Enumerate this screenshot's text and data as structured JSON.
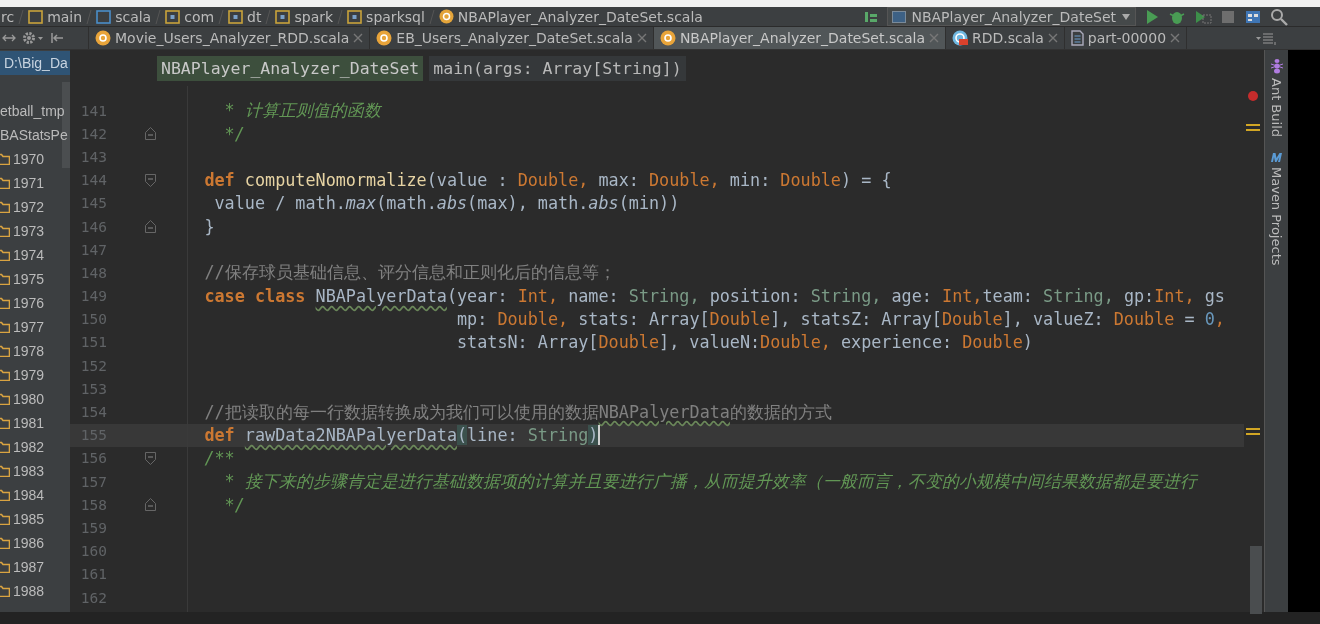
{
  "navigation_bar": {
    "crumbs": [
      {
        "label": "rc",
        "kind": "plain"
      },
      {
        "label": "main",
        "kind": "folder"
      },
      {
        "label": "scala",
        "kind": "source-folder"
      },
      {
        "label": "com",
        "kind": "package"
      },
      {
        "label": "dt",
        "kind": "package"
      },
      {
        "label": "spark",
        "kind": "package"
      },
      {
        "label": "sparksql",
        "kind": "package"
      },
      {
        "label": "NBAPlayer_Analyzer_DateSet.scala",
        "kind": "file"
      }
    ],
    "run_configuration": "NBAPlayer_Analyzer_DateSet"
  },
  "tabs": [
    {
      "label": "Movie_Users_Analyzer_RDD.scala",
      "kind": "object",
      "selected": false
    },
    {
      "label": "EB_Users_Analyzer_DateSet.scala",
      "kind": "object",
      "selected": false
    },
    {
      "label": "NBAPlayer_Analyzer_DateSet.scala",
      "kind": "object",
      "selected": true
    },
    {
      "label": "RDD.scala",
      "kind": "class",
      "selected": false
    },
    {
      "label": "part-00000",
      "kind": "text",
      "selected": false
    }
  ],
  "project_tree": [
    {
      "label": "D:\\Big_Da",
      "selected": true
    },
    {
      "label": "etball_tmp",
      "selected": false
    },
    {
      "label": "BAStatsPe",
      "selected": false,
      "children": [
        {
          "label": "1970",
          "selected": false
        },
        {
          "label": "1971",
          "selected": false
        },
        {
          "label": "1972",
          "selected": false
        },
        {
          "label": "1973",
          "selected": false
        },
        {
          "label": "1974",
          "selected": false
        },
        {
          "label": "1975",
          "selected": false
        },
        {
          "label": "1976",
          "selected": false
        },
        {
          "label": "1977",
          "selected": false
        },
        {
          "label": "1978",
          "selected": false
        },
        {
          "label": "1979",
          "selected": false
        },
        {
          "label": "1980",
          "selected": false
        },
        {
          "label": "1981",
          "selected": false
        },
        {
          "label": "1982",
          "selected": false
        },
        {
          "label": "1983",
          "selected": false
        },
        {
          "label": "1984",
          "selected": false
        },
        {
          "label": "1985",
          "selected": false
        },
        {
          "label": "1986",
          "selected": false
        },
        {
          "label": "1987",
          "selected": false
        },
        {
          "label": "1988",
          "selected": false
        }
      ]
    }
  ],
  "editor": {
    "breadcrumbs": [
      {
        "label": "NBAPlayer_Analyzer_DateSet",
        "selected": true
      },
      {
        "label": "main(args: Array[String])",
        "selected": false
      }
    ],
    "lines": [
      {
        "number": "141",
        "current": false,
        "tokens": [
          {
            "kind": "doc",
            "text": "      * 计算正则值的函数"
          }
        ]
      },
      {
        "number": "142",
        "current": false,
        "fold_end": true,
        "tokens": [
          {
            "kind": "doc",
            "text": "      */"
          }
        ]
      },
      {
        "number": "143",
        "current": false
      },
      {
        "number": "144",
        "current": false,
        "fold_start": true,
        "tokens": [
          {
            "kind": "keyword",
            "text": "    def "
          },
          {
            "kind": "function",
            "text": "computeNomormalize"
          },
          {
            "kind": "plain",
            "text": "(value : "
          },
          {
            "kind": "type",
            "text": "Double,"
          },
          {
            "kind": "plain",
            "text": " max: "
          },
          {
            "kind": "type",
            "text": "Double,"
          },
          {
            "kind": "plain",
            "text": " min: "
          },
          {
            "kind": "type",
            "text": "Double"
          },
          {
            "kind": "plain",
            "text": ") = {"
          }
        ]
      },
      {
        "number": "145",
        "current": false,
        "tokens": [
          {
            "kind": "plain",
            "text": "     value / math."
          },
          {
            "kind": "italic",
            "text": "max"
          },
          {
            "kind": "plain",
            "text": "(math."
          },
          {
            "kind": "italic",
            "text": "abs"
          },
          {
            "kind": "plain",
            "text": "(max), math."
          },
          {
            "kind": "italic",
            "text": "abs"
          },
          {
            "kind": "plain",
            "text": "(min))"
          }
        ]
      },
      {
        "number": "146",
        "current": false,
        "fold_end": true,
        "tokens": [
          {
            "kind": "plain",
            "text": "    }"
          }
        ]
      },
      {
        "number": "147",
        "current": false
      },
      {
        "number": "148",
        "current": false,
        "tokens": [
          {
            "kind": "comment",
            "text": "    //保存球员基础信息、评分信息和正则化后的信息等；"
          }
        ]
      },
      {
        "number": "149",
        "current": false,
        "tokens": [
          {
            "kind": "keyword",
            "text": "    case class "
          },
          {
            "kind": "typo",
            "text": "NBAPalyerData"
          },
          {
            "kind": "plain",
            "text": "(year: "
          },
          {
            "kind": "type",
            "text": "Int,"
          },
          {
            "kind": "plain",
            "text": " name: "
          },
          {
            "kind": "string_type",
            "text": "String,"
          },
          {
            "kind": "plain",
            "text": " position: "
          },
          {
            "kind": "string_type",
            "text": "String,"
          },
          {
            "kind": "plain",
            "text": " age: "
          },
          {
            "kind": "type",
            "text": "Int,"
          },
          {
            "kind": "plain",
            "text": "team: "
          },
          {
            "kind": "string_type",
            "text": "String,"
          },
          {
            "kind": "plain",
            "text": " gp:"
          },
          {
            "kind": "type",
            "text": "Int,"
          },
          {
            "kind": "plain",
            "text": " gs"
          }
        ]
      },
      {
        "number": "150",
        "current": false,
        "tokens": [
          {
            "kind": "plain",
            "text": "                             mp: "
          },
          {
            "kind": "type",
            "text": "Double,"
          },
          {
            "kind": "plain",
            "text": " stats: Array["
          },
          {
            "kind": "type",
            "text": "Double"
          },
          {
            "kind": "plain",
            "text": "], statsZ: Array["
          },
          {
            "kind": "type",
            "text": "Double"
          },
          {
            "kind": "plain",
            "text": "], valueZ: "
          },
          {
            "kind": "type",
            "text": "Double"
          },
          {
            "kind": "plain",
            "text": " = "
          },
          {
            "kind": "number",
            "text": "0"
          },
          {
            "kind": "type",
            "text": ","
          }
        ]
      },
      {
        "number": "151",
        "current": false,
        "tokens": [
          {
            "kind": "plain",
            "text": "                             statsN: Array["
          },
          {
            "kind": "type",
            "text": "Double"
          },
          {
            "kind": "plain",
            "text": "], valueN:"
          },
          {
            "kind": "type",
            "text": "Double,"
          },
          {
            "kind": "plain",
            "text": " experience: "
          },
          {
            "kind": "type",
            "text": "Double"
          },
          {
            "kind": "plain",
            "text": ")"
          }
        ]
      },
      {
        "number": "152",
        "current": false
      },
      {
        "number": "153",
        "current": false
      },
      {
        "number": "154",
        "current": false,
        "tokens": [
          {
            "kind": "comment",
            "text": "    //把读取的每一行数据转换成为我们可以使用的数据"
          },
          {
            "kind": "comment_typo",
            "text": "NBAPalyerData"
          },
          {
            "kind": "comment",
            "text": "的数据的方式"
          }
        ]
      },
      {
        "number": "155",
        "current": true,
        "tokens": [
          {
            "kind": "keyword",
            "text": "    def "
          },
          {
            "kind": "typo",
            "text": "rawData2NBAPalyerData"
          },
          {
            "kind": "brace",
            "text": "("
          },
          {
            "kind": "plain",
            "text": "line: "
          },
          {
            "kind": "string_type",
            "text": "String"
          },
          {
            "kind": "brace",
            "text": ")"
          }
        ]
      },
      {
        "number": "156",
        "current": false,
        "fold_start": true,
        "tokens": [
          {
            "kind": "doc",
            "text": "    /**"
          }
        ]
      },
      {
        "number": "157",
        "current": false,
        "tokens": [
          {
            "kind": "doc",
            "text": "      * 接下来的步骤肯定是进行基础数据项的计算并且要进行广播，从而提升效率（一般而言，不变的小规模中间结果数据都是要进行"
          }
        ]
      },
      {
        "number": "158",
        "current": false,
        "fold_end": true,
        "tokens": [
          {
            "kind": "doc",
            "text": "      */"
          }
        ]
      },
      {
        "number": "159",
        "current": false
      },
      {
        "number": "160",
        "current": false
      },
      {
        "number": "161",
        "current": false
      },
      {
        "number": "162",
        "current": false
      }
    ]
  },
  "tool_windows": [
    {
      "label": "Ant Build",
      "kind": "ant"
    },
    {
      "label": "Maven Projects",
      "kind": "maven"
    }
  ]
}
